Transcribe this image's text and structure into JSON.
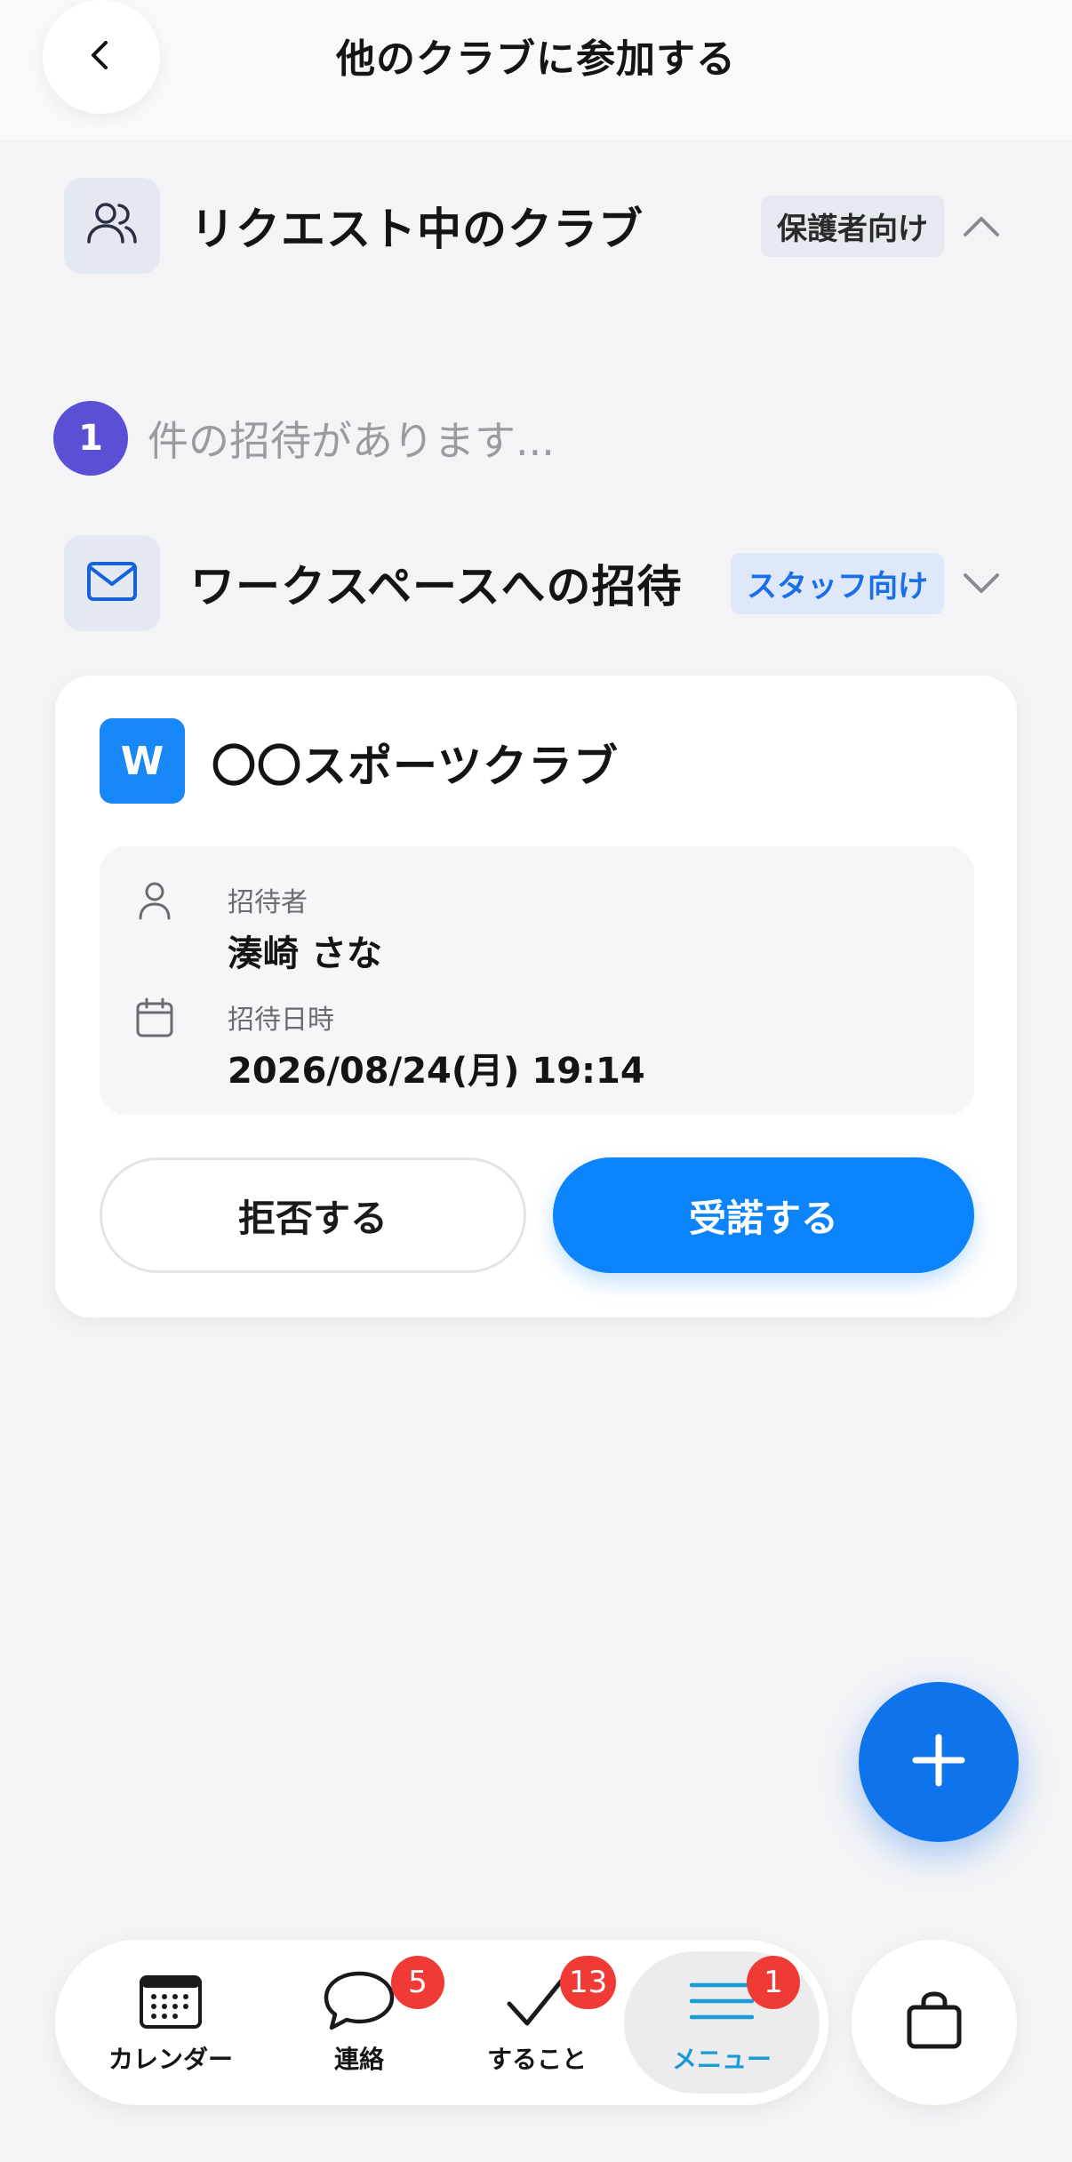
{
  "header": {
    "title": "他のクラブに参加する",
    "back_icon": "chevron-left-icon"
  },
  "requesting_section": {
    "icon": "users-icon",
    "title": "リクエスト中のクラブ",
    "tag": "保護者向け",
    "expanded": true
  },
  "invite_count": {
    "count": "1",
    "text": "件の招待があります..."
  },
  "workspace_section": {
    "icon": "mail-icon",
    "title": "ワークスペースへの招待",
    "tag": "スタッフ向け",
    "expanded": false
  },
  "invite_card": {
    "logo_letter": "W",
    "club_name": "〇〇スポーツクラブ",
    "inviter_label": "招待者",
    "inviter_name": "湊崎 さな",
    "date_label": "招待日時",
    "date_value": "2026/08/24(月) 19:14",
    "decline_label": "拒否する",
    "accept_label": "受諾する"
  },
  "fab": {
    "icon": "plus-icon"
  },
  "nav": {
    "items": [
      {
        "label": "カレンダー",
        "icon": "calendar-icon",
        "badge": ""
      },
      {
        "label": "連絡",
        "icon": "chat-bubble-icon",
        "badge": "5"
      },
      {
        "label": "すること",
        "icon": "checkmark-icon",
        "badge": "13"
      },
      {
        "label": "メニュー",
        "icon": "menu-icon",
        "badge": "1"
      }
    ],
    "active_index": 3,
    "cart_icon": "shopping-bag-icon"
  },
  "colors": {
    "accent": "#0b84fb",
    "badge": "#f03a36",
    "count_badge": "#5b4fd6",
    "active_nav": "#1a9ad6"
  }
}
